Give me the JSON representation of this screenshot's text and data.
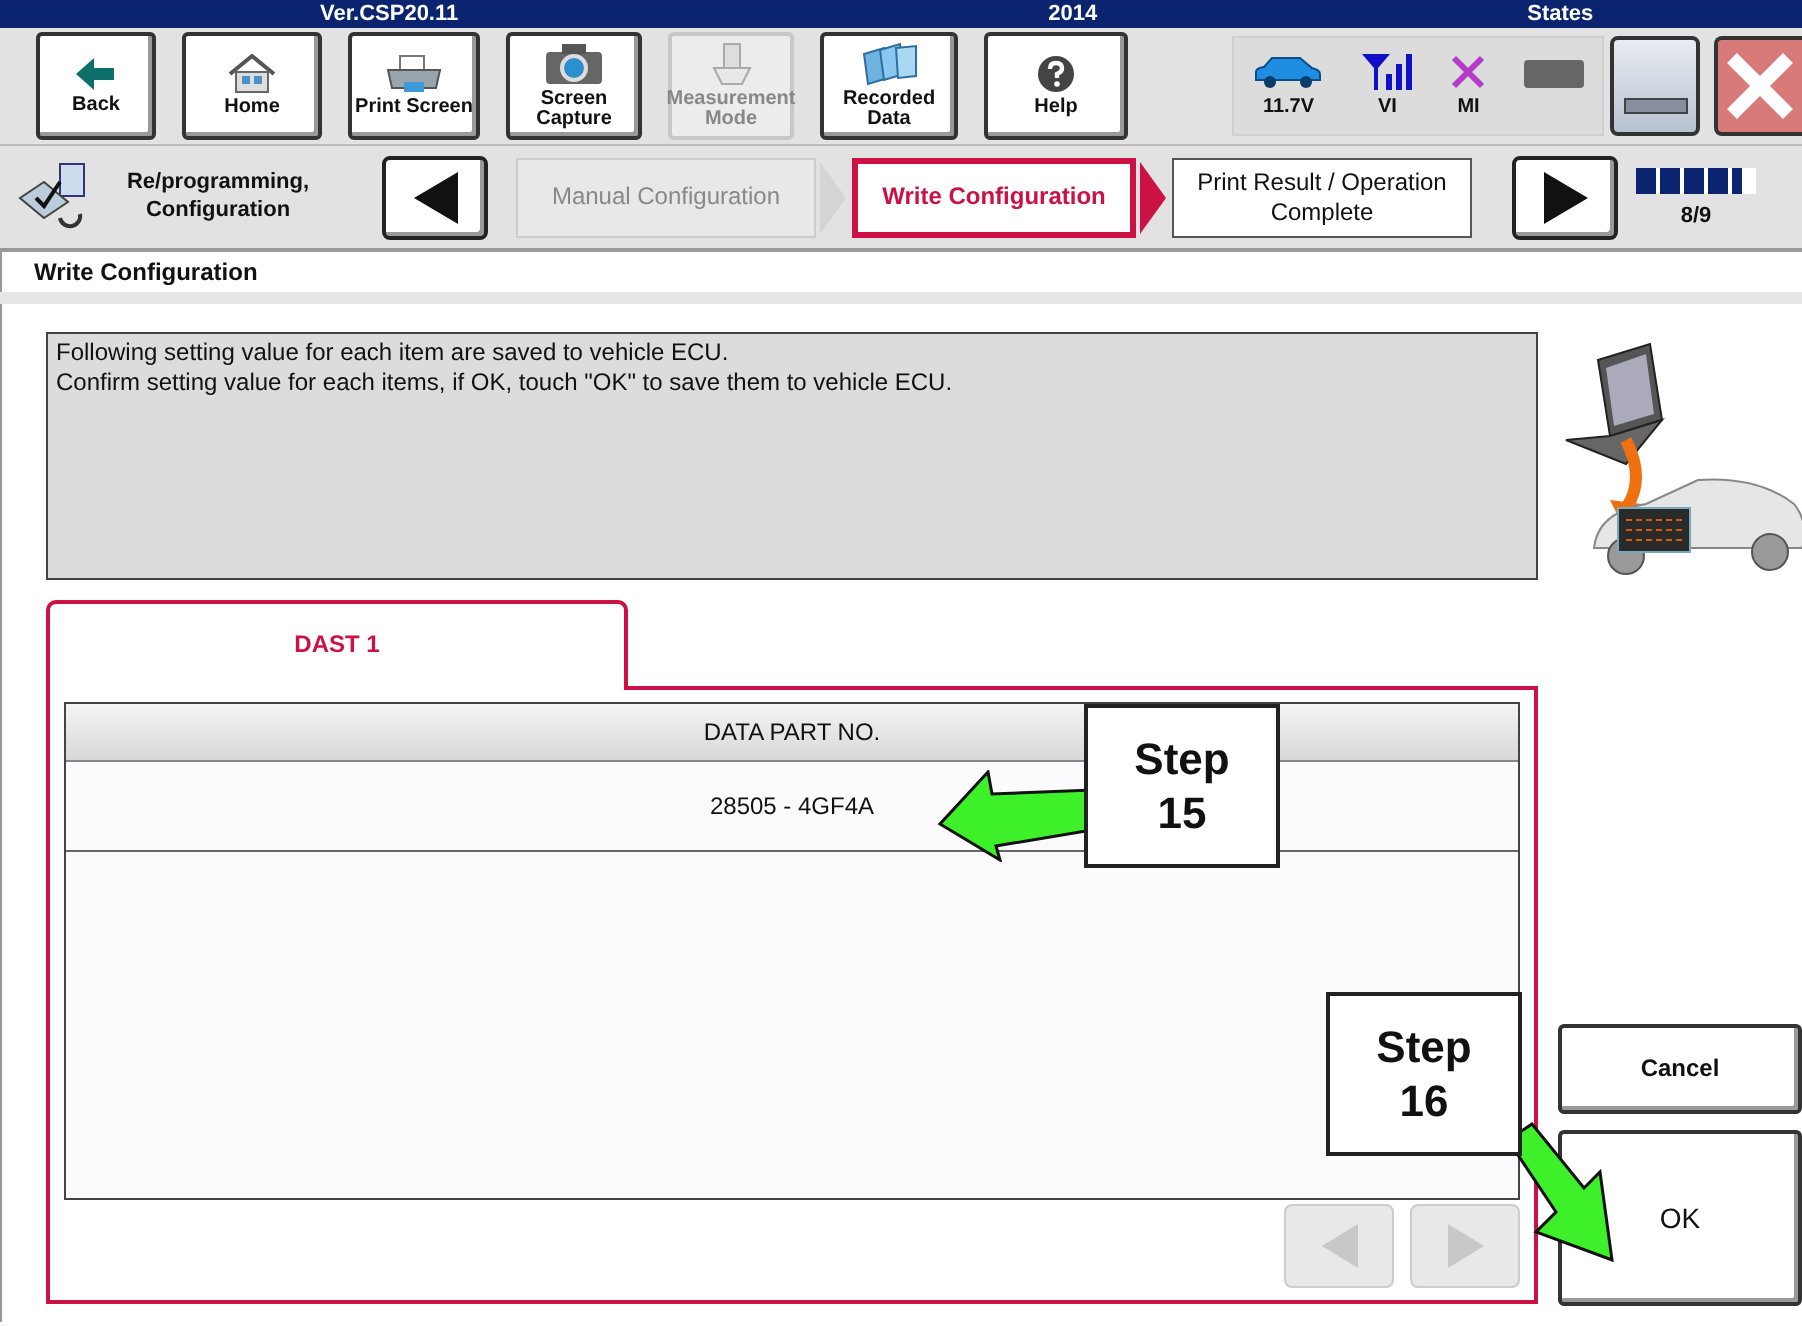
{
  "title_bar": {
    "texts": [
      "Ver.CSP20.11",
      "2014",
      "States"
    ]
  },
  "toolbar": {
    "buttons": [
      {
        "label": "Back",
        "disabled": false
      },
      {
        "label": "Home",
        "disabled": false
      },
      {
        "label": "Print Screen",
        "disabled": false
      },
      {
        "label": "Screen Capture",
        "disabled": false
      },
      {
        "label": "Measurement Mode",
        "disabled": true
      },
      {
        "label": "Recorded Data",
        "disabled": false
      },
      {
        "label": "Help",
        "disabled": false
      }
    ],
    "status": [
      {
        "label": "11.7V"
      },
      {
        "label": "VI"
      },
      {
        "label": "MI"
      }
    ]
  },
  "step_bar": {
    "title": "Re/programming, Configuration",
    "steps": [
      {
        "label": "Manual Configuration",
        "disabled": true,
        "selected": false
      },
      {
        "label": "Write Configuration",
        "disabled": false,
        "selected": true
      },
      {
        "label": "Print Result / Operation Complete",
        "disabled": false,
        "selected": false
      }
    ],
    "progress": {
      "level": 0.89,
      "reading": "8/9"
    }
  },
  "section_title": "Write Configuration",
  "message": [
    "Following setting value for each item are saved to vehicle ECU.",
    "Confirm setting value for each items, if OK, touch \"OK\" to save them to vehicle ECU."
  ],
  "tabs": [
    {
      "label": "DAST 1",
      "selected": true
    }
  ],
  "table": {
    "columns": [
      "DATA PART NO."
    ],
    "rows": [
      [
        "28505 - 4GF4A"
      ]
    ]
  },
  "pager": {
    "prev_disabled": true,
    "next_disabled": true
  },
  "buttons": [
    {
      "label": "Cancel"
    },
    {
      "label": "OK"
    }
  ],
  "callouts": [
    {
      "label": "Step 15"
    },
    {
      "label": "Step 16"
    }
  ]
}
